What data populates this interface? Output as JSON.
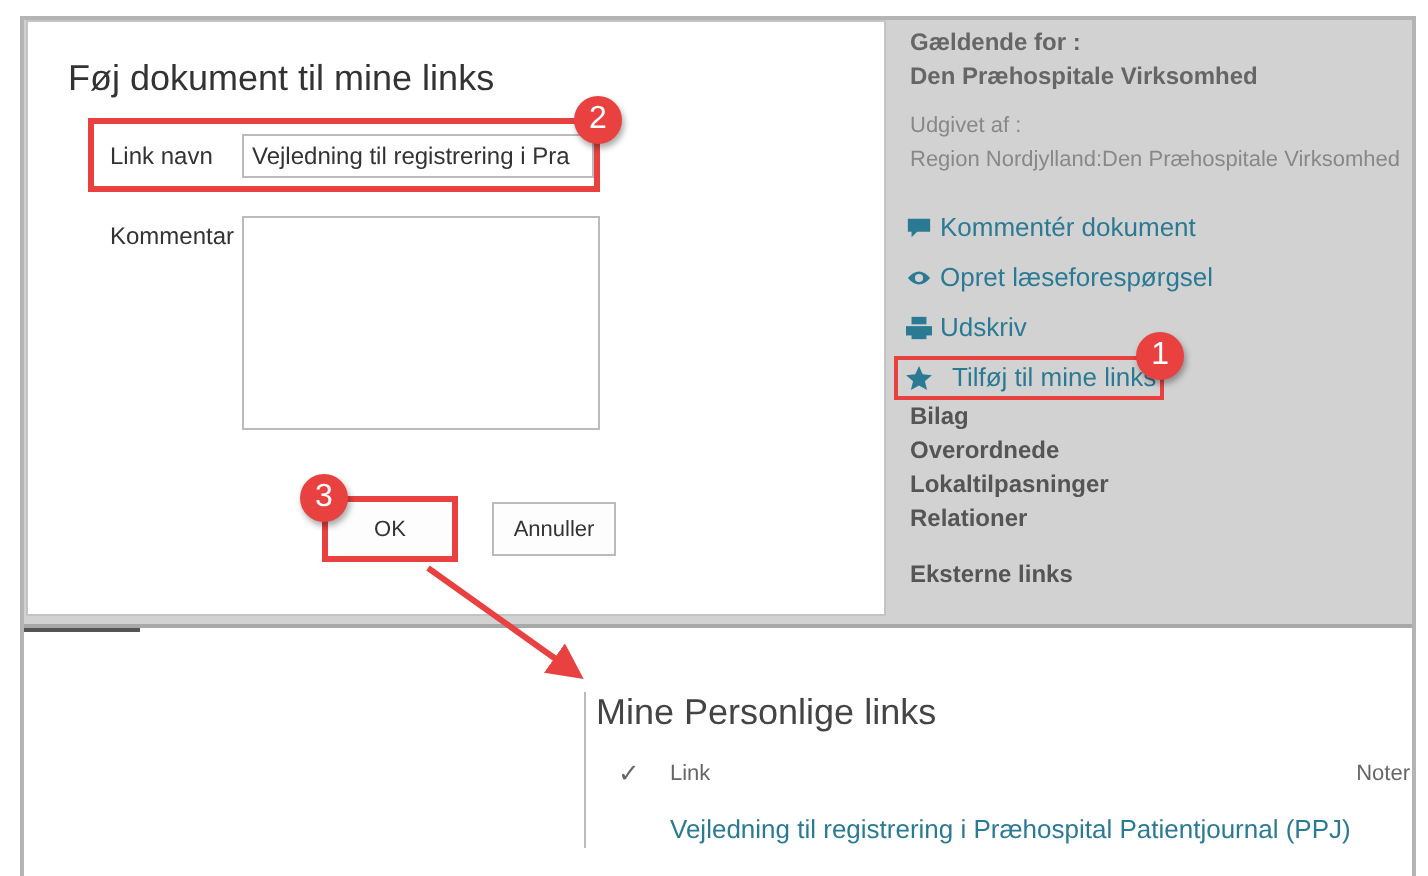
{
  "dialog": {
    "title": "Føj dokument til mine links",
    "link_field": {
      "label": "Link navn",
      "value": "Vejledning til registrering i Pra",
      "callout": "2"
    },
    "comment_field": {
      "label": "Kommentar"
    },
    "buttons": [
      {
        "label": "OK",
        "callout": "3"
      },
      {
        "label": "Annuller"
      }
    ]
  },
  "side_panel": {
    "applies_label": "Gældende for :",
    "applies_value": "Den Præhospitale Virksomhed",
    "published_label": "Udgivet af :",
    "published_value": "Region Nordjylland:Den Præhospitale Virksomhed",
    "actions": [
      {
        "kind": "comment",
        "label": "Kommentér dokument"
      },
      {
        "kind": "eye",
        "label": "Opret læseforespørgsel"
      },
      {
        "kind": "print",
        "label": "Udskriv"
      },
      {
        "kind": "star",
        "label": "Tilføj til mine links",
        "callout": "1"
      }
    ],
    "sections": [
      "Bilag",
      "Overordnede",
      "Lokaltilpasninger",
      "Relationer"
    ],
    "external": "Eksterne links"
  },
  "personal_links": {
    "title": "Mine Personlige links",
    "columns": [
      "✓",
      "Link",
      "Noter"
    ],
    "rows": [
      {
        "link": "Vejledning til registrering i Præhospital Patientjournal (PPJ)"
      }
    ]
  }
}
